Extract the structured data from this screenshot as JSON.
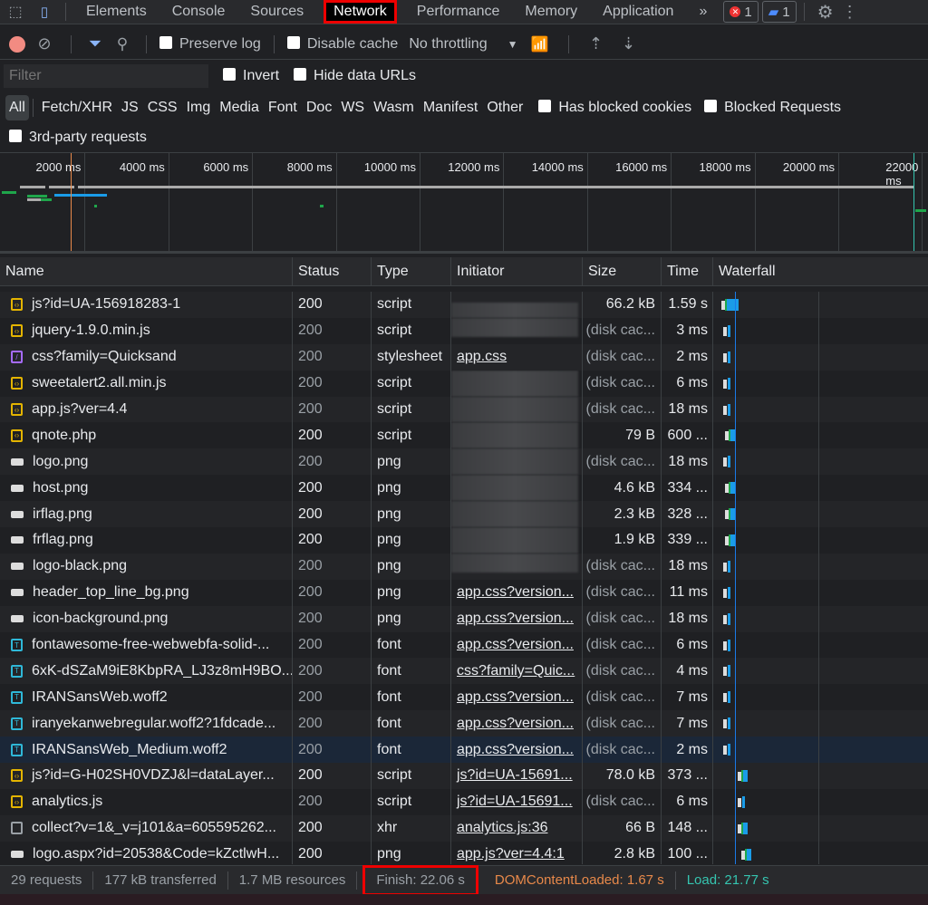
{
  "tabs": {
    "items": [
      "Elements",
      "Console",
      "Sources",
      "Network",
      "Performance",
      "Memory",
      "Application"
    ],
    "active": "Network",
    "more": "»",
    "errors": "1",
    "messages": "1"
  },
  "toolbar": {
    "preserve_log": "Preserve log",
    "disable_cache": "Disable cache",
    "throttling": "No throttling"
  },
  "filter": {
    "placeholder": "Filter",
    "invert": "Invert",
    "hide_data_urls": "Hide data URLs"
  },
  "types": {
    "items": [
      "All",
      "Fetch/XHR",
      "JS",
      "CSS",
      "Img",
      "Media",
      "Font",
      "Doc",
      "WS",
      "Wasm",
      "Manifest",
      "Other"
    ],
    "selected": "All",
    "has_blocked_cookies": "Has blocked cookies",
    "blocked_requests": "Blocked Requests",
    "third_party": "3rd-party requests"
  },
  "overview": {
    "ticks": [
      "2000 ms",
      "4000 ms",
      "6000 ms",
      "8000 ms",
      "10000 ms",
      "12000 ms",
      "14000 ms",
      "16000 ms",
      "18000 ms",
      "20000 ms",
      "22000 ms"
    ]
  },
  "columns": [
    "Name",
    "Status",
    "Type",
    "Initiator",
    "Size",
    "Time",
    "Waterfall"
  ],
  "rows": [
    {
      "name": "js?id=UA-156918283-1",
      "icon": "script",
      "status": "200",
      "type": "script",
      "initiator": "",
      "size": "66.2 kB",
      "time": "1.59 s",
      "cached": false
    },
    {
      "name": "jquery-1.9.0.min.js",
      "icon": "script",
      "status": "200",
      "type": "script",
      "initiator": "",
      "size": "(disk cac...",
      "time": "3 ms",
      "cached": true
    },
    {
      "name": "css?family=Quicksand",
      "icon": "stylesheet",
      "status": "200",
      "type": "stylesheet",
      "initiator": "app.css",
      "size": "(disk cac...",
      "time": "2 ms",
      "cached": true
    },
    {
      "name": "sweetalert2.all.min.js",
      "icon": "script",
      "status": "200",
      "type": "script",
      "initiator": "",
      "size": "(disk cac...",
      "time": "6 ms",
      "cached": true
    },
    {
      "name": "app.js?ver=4.4",
      "icon": "script",
      "status": "200",
      "type": "script",
      "initiator": "",
      "size": "(disk cac...",
      "time": "18 ms",
      "cached": true
    },
    {
      "name": "qnote.php",
      "icon": "script",
      "status": "200",
      "type": "script",
      "initiator": "",
      "size": "79 B",
      "time": "600 ...",
      "cached": false
    },
    {
      "name": "logo.png",
      "icon": "image",
      "status": "200",
      "type": "png",
      "initiator": "",
      "size": "(disk cac...",
      "time": "18 ms",
      "cached": true
    },
    {
      "name": "host.png",
      "icon": "image",
      "status": "200",
      "type": "png",
      "initiator": "",
      "size": "4.6 kB",
      "time": "334 ...",
      "cached": false
    },
    {
      "name": "irflag.png",
      "icon": "image",
      "status": "200",
      "type": "png",
      "initiator": "",
      "size": "2.3 kB",
      "time": "328 ...",
      "cached": false
    },
    {
      "name": "frflag.png",
      "icon": "image",
      "status": "200",
      "type": "png",
      "initiator": "",
      "size": "1.9 kB",
      "time": "339 ...",
      "cached": false
    },
    {
      "name": "logo-black.png",
      "icon": "image",
      "status": "200",
      "type": "png",
      "initiator": "",
      "size": "(disk cac...",
      "time": "18 ms",
      "cached": true
    },
    {
      "name": "header_top_line_bg.png",
      "icon": "image",
      "status": "200",
      "type": "png",
      "initiator": "app.css?version...",
      "size": "(disk cac...",
      "time": "11 ms",
      "cached": true
    },
    {
      "name": "icon-background.png",
      "icon": "image",
      "status": "200",
      "type": "png",
      "initiator": "app.css?version...",
      "size": "(disk cac...",
      "time": "18 ms",
      "cached": true
    },
    {
      "name": "fontawesome-free-webwebfa-solid-...",
      "icon": "font",
      "status": "200",
      "type": "font",
      "initiator": "app.css?version...",
      "size": "(disk cac...",
      "time": "6 ms",
      "cached": true
    },
    {
      "name": "6xK-dSZaM9iE8KbpRA_LJ3z8mH9BO...",
      "icon": "font",
      "status": "200",
      "type": "font",
      "initiator": "css?family=Quic...",
      "size": "(disk cac...",
      "time": "4 ms",
      "cached": true
    },
    {
      "name": "IRANSansWeb.woff2",
      "icon": "font",
      "status": "200",
      "type": "font",
      "initiator": "app.css?version...",
      "size": "(disk cac...",
      "time": "7 ms",
      "cached": true
    },
    {
      "name": "iranyekanwebregular.woff2?1fdcade...",
      "icon": "font",
      "status": "200",
      "type": "font",
      "initiator": "app.css?version...",
      "size": "(disk cac...",
      "time": "7 ms",
      "cached": true
    },
    {
      "name": "IRANSansWeb_Medium.woff2",
      "icon": "font",
      "status": "200",
      "type": "font",
      "initiator": "app.css?version...",
      "size": "(disk cac...",
      "time": "2 ms",
      "cached": true,
      "selected": true
    },
    {
      "name": "js?id=G-H02SH0VDZJ&l=dataLayer...",
      "icon": "script",
      "status": "200",
      "type": "script",
      "initiator": "js?id=UA-15691...",
      "size": "78.0 kB",
      "time": "373 ...",
      "cached": false
    },
    {
      "name": "analytics.js",
      "icon": "script",
      "status": "200",
      "type": "script",
      "initiator": "js?id=UA-15691...",
      "size": "(disk cac...",
      "time": "6 ms",
      "cached": true
    },
    {
      "name": "collect?v=1&_v=j101&a=605595262...",
      "icon": "xhr",
      "status": "200",
      "type": "xhr",
      "initiator": "analytics.js:36",
      "size": "66 B",
      "time": "148 ...",
      "cached": false
    },
    {
      "name": "logo.aspx?id=20538&Code=kZctlwH...",
      "icon": "image",
      "status": "200",
      "type": "png",
      "initiator": "app.js?ver=4.4:1",
      "size": "2.8 kB",
      "time": "100 ...",
      "cached": false
    }
  ],
  "footer": {
    "requests": "29 requests",
    "transferred": "177 kB transferred",
    "resources": "1.7 MB resources",
    "finish": "Finish: 22.06 s",
    "dcl": "DOMContentLoaded: 1.67 s",
    "load": "Load: 21.77 s"
  },
  "colors": {
    "dcl": "#e8894a",
    "load": "#35c5b0",
    "script": "#e4b400",
    "stylesheet": "#a66bff",
    "font": "#2fb8d8",
    "waterfall_blue": "#1a9ce8",
    "waterfall_green": "#1fa64b",
    "highlight": "#e00000"
  }
}
